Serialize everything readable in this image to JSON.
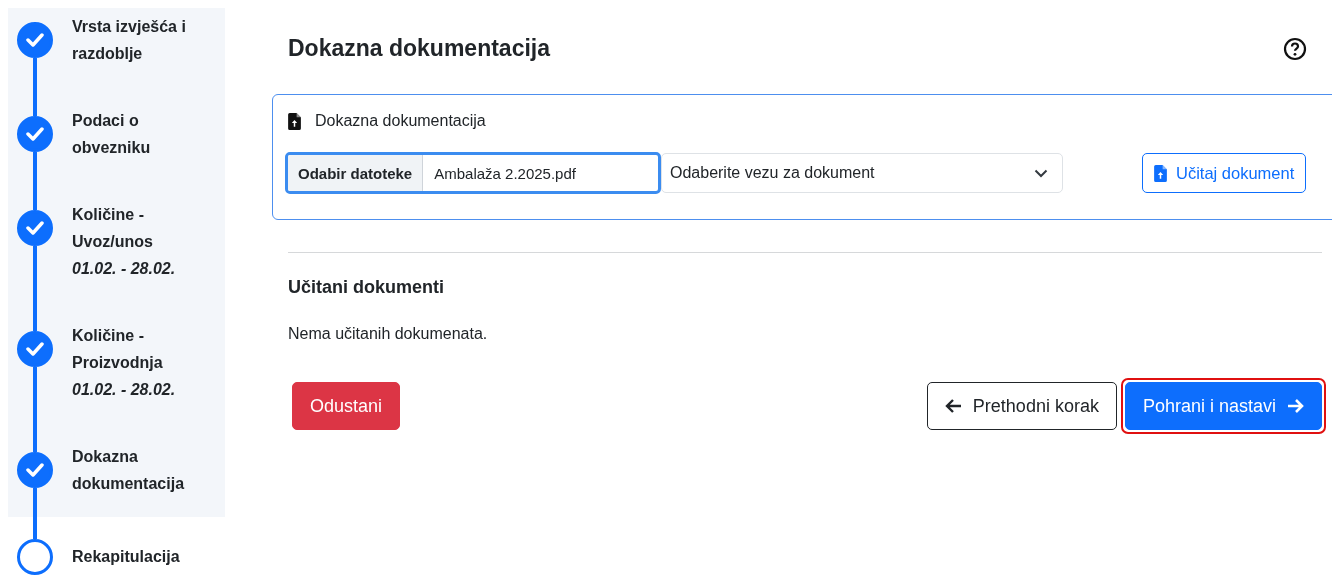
{
  "steps": [
    {
      "lines": [
        "Vrsta izvješća i",
        "razdoblje"
      ],
      "completed": true
    },
    {
      "lines": [
        "Podaci o",
        "obvezniku"
      ],
      "completed": true
    },
    {
      "lines": [
        "Količine -",
        "Uvoz/unos"
      ],
      "period": "01.02. - 28.02.",
      "completed": true
    },
    {
      "lines": [
        "Količine -",
        "Proizvodnja"
      ],
      "period": "01.02. - 28.02.",
      "completed": true
    },
    {
      "lines": [
        "Dokazna",
        "dokumentacija"
      ],
      "completed": true
    },
    {
      "lines": [
        "Rekapitulacija"
      ],
      "completed": false
    }
  ],
  "page": {
    "title": "Dokazna dokumentacija"
  },
  "upload_card": {
    "title": "Dokazna dokumentacija",
    "file_button": "Odabir datoteke",
    "file_name": "Ambalaža 2.2025.pdf",
    "file_focused": true,
    "select_placeholder": "Odaberite vezu za dokument",
    "upload_button": "Učitaj dokument"
  },
  "documents": {
    "title": "Učitani dokumenti",
    "empty_text": "Nema učitanih dokumenata."
  },
  "buttons": [
    {
      "kind": "cancel",
      "label": "Odustani",
      "highlighted": false
    },
    {
      "kind": "previous",
      "label": "Prethodni korak",
      "highlighted": false
    },
    {
      "kind": "next",
      "label": "Pohrani i nastavi",
      "highlighted": true
    }
  ]
}
